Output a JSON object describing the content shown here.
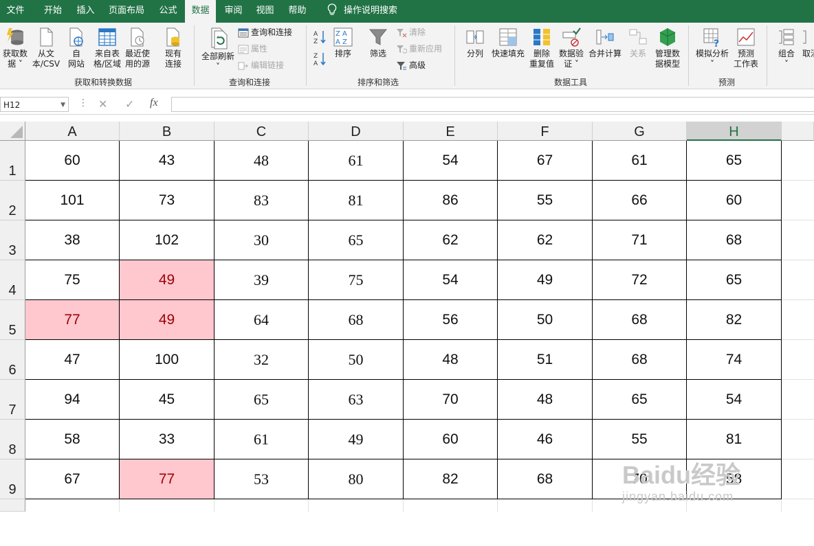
{
  "menu": {
    "tabs": [
      "文件",
      "开始",
      "插入",
      "页面布局",
      "公式",
      "数据",
      "审阅",
      "视图",
      "帮助"
    ],
    "active_tab": "数据",
    "tell_me": "操作说明搜索"
  },
  "ribbon": {
    "get_transform": {
      "get_data": "获取数\n据 ˅",
      "from_text_csv": "从文\n本/CSV",
      "from_web": "自\n网站",
      "from_table": "来自表\n格/区域",
      "recent_sources": "最近使\n用的源",
      "existing_connections": "现有\n连接",
      "group_label": "获取和转换数据"
    },
    "queries": {
      "refresh_all": "全部刷新\n˅",
      "queries_connections": "查询和连接",
      "properties": "属性",
      "edit_links": "编辑链接",
      "group_label": "查询和连接"
    },
    "sort_filter": {
      "sort": "排序",
      "filter": "筛选",
      "clear": "清除",
      "reapply": "重新应用",
      "advanced": "高级",
      "group_label": "排序和筛选"
    },
    "data_tools": {
      "text_to_columns": "分列",
      "flash_fill": "快速填充",
      "remove_duplicates": "删除\n重复值",
      "data_validation": "数据验\n证 ˅",
      "consolidate": "合并计算",
      "relationships": "关系",
      "manage_data_model": "管理数\n据模型",
      "group_label": "数据工具"
    },
    "forecast": {
      "what_if": "模拟分析\n˅",
      "forecast_sheet": "预测\n工作表",
      "group_label": "预测"
    },
    "outline": {
      "group": "组合\n˅",
      "ungroup": "取消"
    }
  },
  "formula_bar": {
    "name_box": "H12",
    "cancel_icon": "✕",
    "enter_icon": "✓",
    "fx_label": "fx",
    "value": ""
  },
  "sheet": {
    "columns": [
      "A",
      "B",
      "C",
      "D",
      "E",
      "F",
      "G",
      "H"
    ],
    "selected_column": "H",
    "rows": [
      [
        "60",
        "43",
        "48",
        "61",
        "54",
        "67",
        "61",
        "65"
      ],
      [
        "101",
        "73",
        "83",
        "81",
        "86",
        "55",
        "66",
        "60"
      ],
      [
        "38",
        "102",
        "30",
        "65",
        "62",
        "62",
        "71",
        "68"
      ],
      [
        "75",
        "49",
        "39",
        "75",
        "54",
        "49",
        "72",
        "65"
      ],
      [
        "77",
        "49",
        "64",
        "68",
        "56",
        "50",
        "68",
        "82"
      ],
      [
        "47",
        "100",
        "32",
        "50",
        "48",
        "51",
        "68",
        "74"
      ],
      [
        "94",
        "45",
        "65",
        "63",
        "70",
        "48",
        "65",
        "54"
      ],
      [
        "58",
        "33",
        "61",
        "49",
        "60",
        "46",
        "55",
        "81"
      ],
      [
        "67",
        "77",
        "53",
        "80",
        "82",
        "68",
        "70",
        "58"
      ]
    ],
    "row_labels": [
      "1",
      "2",
      "3",
      "4",
      "5",
      "6",
      "7",
      "8",
      "9"
    ],
    "highlighted_cells": [
      "B4",
      "A5",
      "B5",
      "B9"
    ],
    "highlight_fill": "#ffc7ce",
    "highlight_text": "#9c0006",
    "header_accent": "#217346"
  },
  "watermark": {
    "text": "Baidu经验",
    "url": "jingyan.baidu.com"
  }
}
